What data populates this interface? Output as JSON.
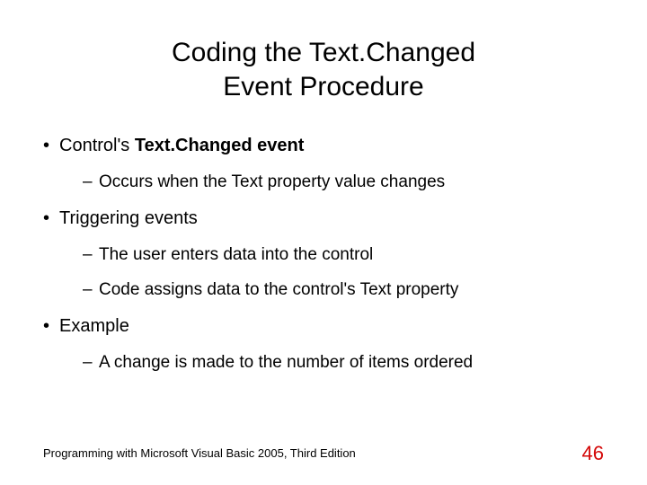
{
  "title_line1": "Coding the Text.Changed",
  "title_line2": "Event Procedure",
  "bullets": {
    "b1_prefix": "Control's ",
    "b1_bold": "Text.Changed event",
    "b1_sub1": "Occurs when the Text property value changes",
    "b2": "Triggering events",
    "b2_sub1": "The user enters data into the control",
    "b2_sub2": "Code assigns data to the control's Text property",
    "b3": "Example",
    "b3_sub1": "A change is made to the number of items ordered"
  },
  "footer_left": "Programming with Microsoft Visual Basic 2005, Third Edition",
  "footer_right": "46"
}
